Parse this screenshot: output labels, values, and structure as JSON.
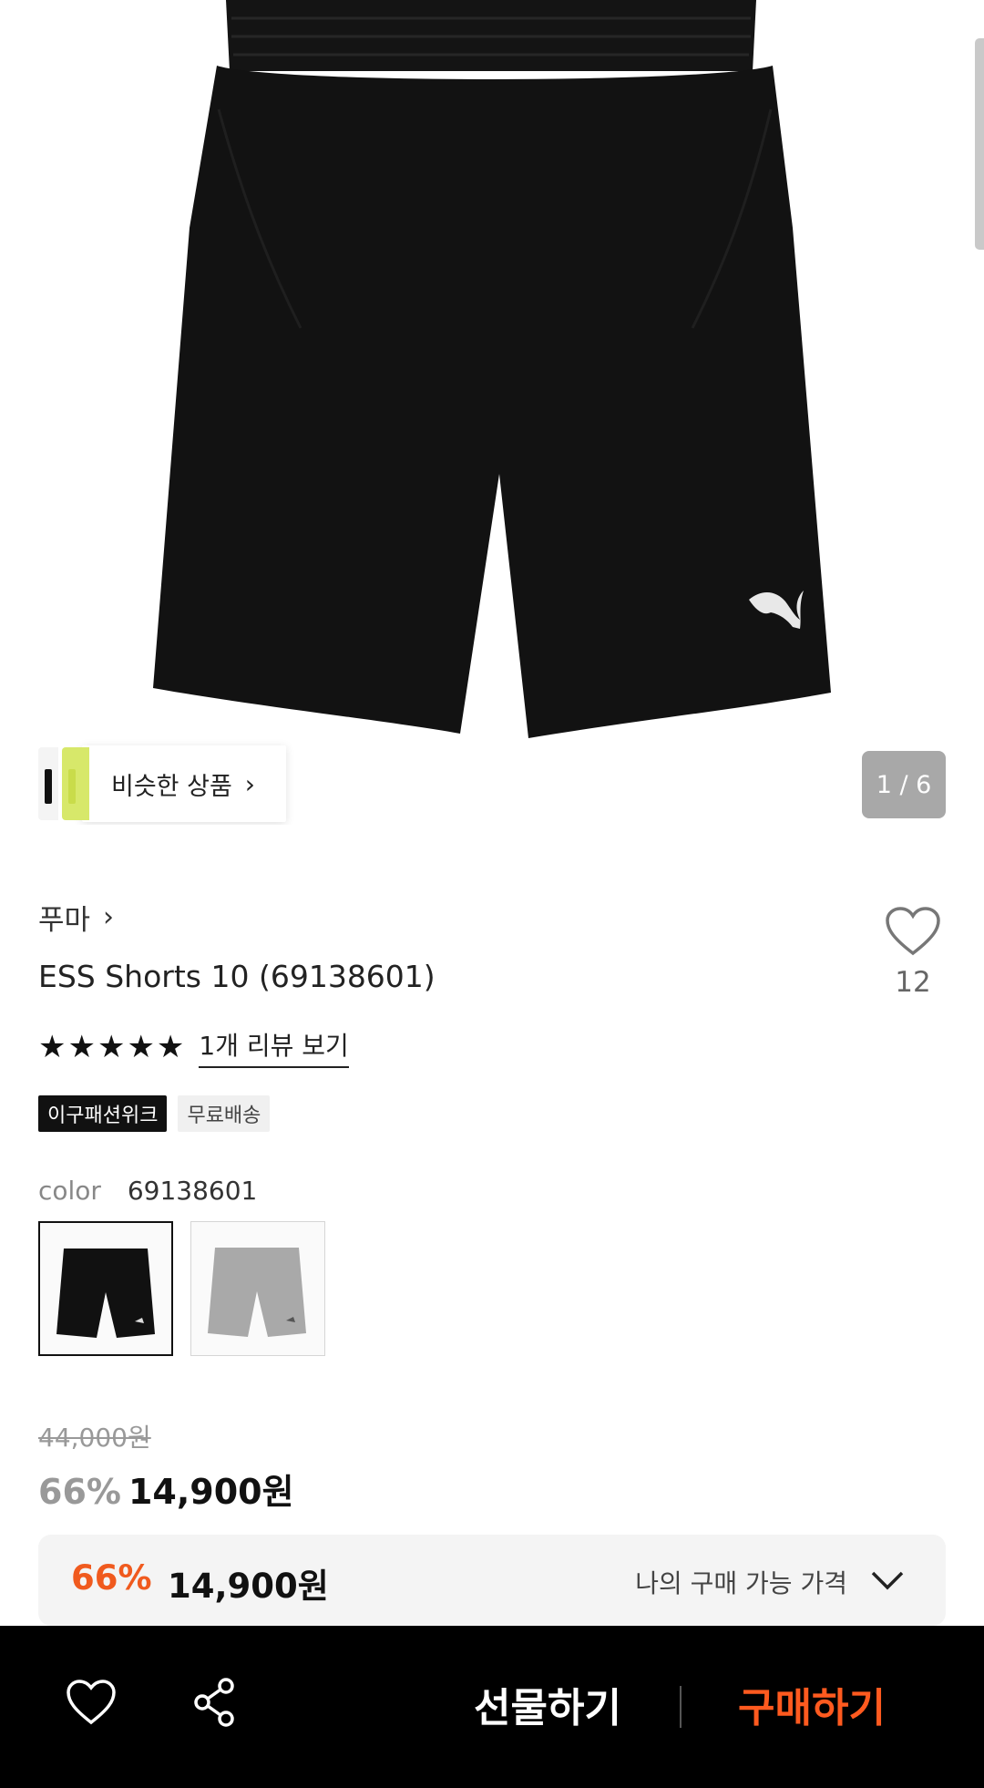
{
  "gallery": {
    "similar_label": "비슷한 상품",
    "counter": "1 / 6"
  },
  "product": {
    "brand": "푸마",
    "title": "ESS Shorts 10 (69138601)",
    "like_count": "12",
    "stars": "★★★★★",
    "rating": 5,
    "review_link": "1개 리뷰 보기",
    "badges": [
      "이구패션위크",
      "무료배송"
    ],
    "color_label": "color",
    "color_value": "69138601",
    "swatches": [
      "black",
      "gray"
    ],
    "original_price": "44,000원",
    "discount": "66%",
    "sale_price": "14,900원"
  },
  "my_price": {
    "discount": "66%",
    "price": "14,900원",
    "label": "나의 구매 가능 가격"
  },
  "bottom_bar": {
    "gift_label": "선물하기",
    "buy_label": "구매하기"
  },
  "colors": {
    "accent_orange": "#f05a1e",
    "buy_orange": "#ff5a1f",
    "product_black": "#111111",
    "product_gray": "#a9a9a9"
  }
}
